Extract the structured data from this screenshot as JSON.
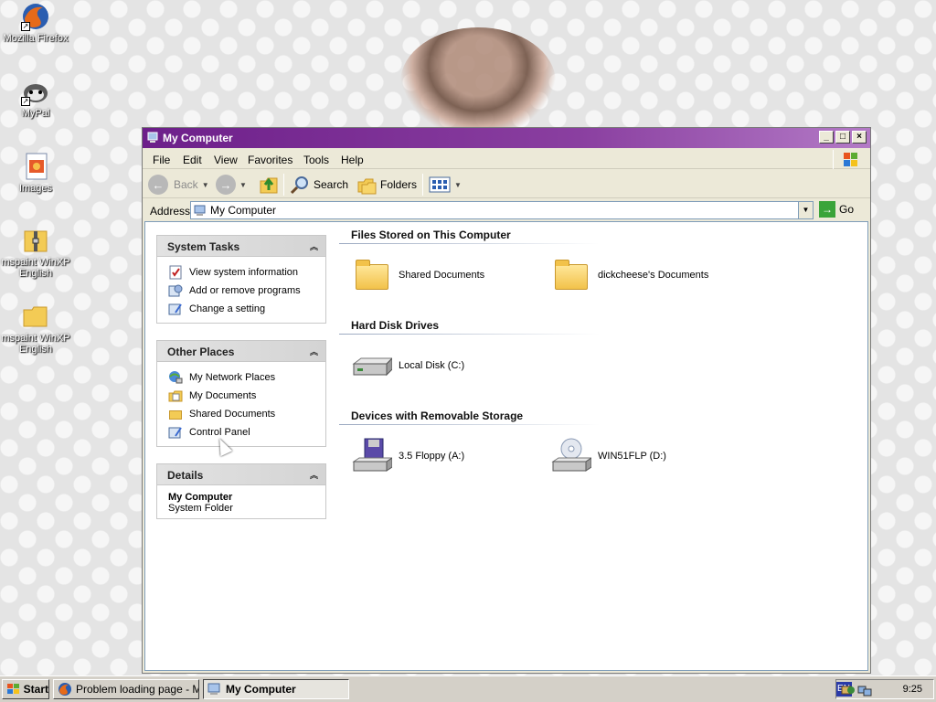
{
  "desktop": {
    "icons": [
      {
        "label": "Mozilla Firefox"
      },
      {
        "label": "MyPal"
      },
      {
        "label": "Images"
      },
      {
        "label": "mspaint WinXP English"
      },
      {
        "label": "mspaint WinXP English"
      }
    ]
  },
  "window": {
    "title": "My Computer",
    "menu": [
      "File",
      "Edit",
      "View",
      "Favorites",
      "Tools",
      "Help"
    ],
    "toolbar": {
      "back": "Back",
      "search": "Search",
      "folders": "Folders"
    },
    "address": {
      "label": "Address",
      "value": "My Computer",
      "go": "Go"
    }
  },
  "tasks": {
    "system": {
      "title": "System Tasks",
      "items": [
        "View system information",
        "Add or remove programs",
        "Change a setting"
      ]
    },
    "other": {
      "title": "Other Places",
      "items": [
        "My Network Places",
        "My Documents",
        "Shared Documents",
        "Control Panel"
      ]
    },
    "details": {
      "title": "Details",
      "name": "My Computer",
      "type": "System Folder"
    }
  },
  "groups": {
    "files": {
      "title": "Files Stored on This Computer",
      "items": [
        "Shared Documents",
        "dickcheese's Documents"
      ]
    },
    "disks": {
      "title": "Hard Disk Drives",
      "items": [
        "Local Disk (C:)"
      ]
    },
    "removable": {
      "title": "Devices with Removable Storage",
      "items": [
        "3.5 Floppy (A:)",
        "WIN51FLP (D:)"
      ]
    }
  },
  "taskbar": {
    "start": "Start",
    "tasks": [
      "Problem loading page - M...",
      "My Computer"
    ],
    "lang": "EN",
    "clock": "9:25"
  },
  "colors": {
    "title_bar": "#6d1f8a",
    "window_bg": "#ece9d8",
    "link": "#000000"
  }
}
